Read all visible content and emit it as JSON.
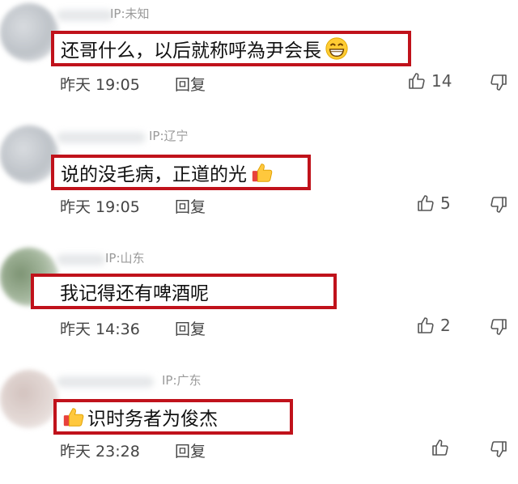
{
  "comments": [
    {
      "ip": "IP:未知",
      "text": "还哥什么，以后就称呼為尹会長",
      "emoji": "grinning-face",
      "time": "昨天 19:05",
      "reply": "回复",
      "likes": "14"
    },
    {
      "ip": "IP:辽宁",
      "text": "说的没毛病，正道的光",
      "emoji": "thumbs-up",
      "time": "昨天 19:05",
      "reply": "回复",
      "likes": "5"
    },
    {
      "ip": "IP:山东",
      "text": "我记得还有啤酒呢",
      "emoji": "",
      "time": "昨天 14:36",
      "reply": "回复",
      "likes": "2"
    },
    {
      "ip": "IP:广东",
      "text": "识时务者为俊杰",
      "emoji": "thumbs-up",
      "time": "昨天 23:28",
      "reply": "回复",
      "likes": ""
    }
  ],
  "colors": {
    "highlight_border": "#c0121b",
    "meta_text": "#444444",
    "ip_text": "#9a9a9a"
  },
  "icons": [
    "thumbs-up-outline-icon",
    "thumbs-down-outline-icon",
    "grinning-face-emoji",
    "thumbs-up-emoji"
  ]
}
